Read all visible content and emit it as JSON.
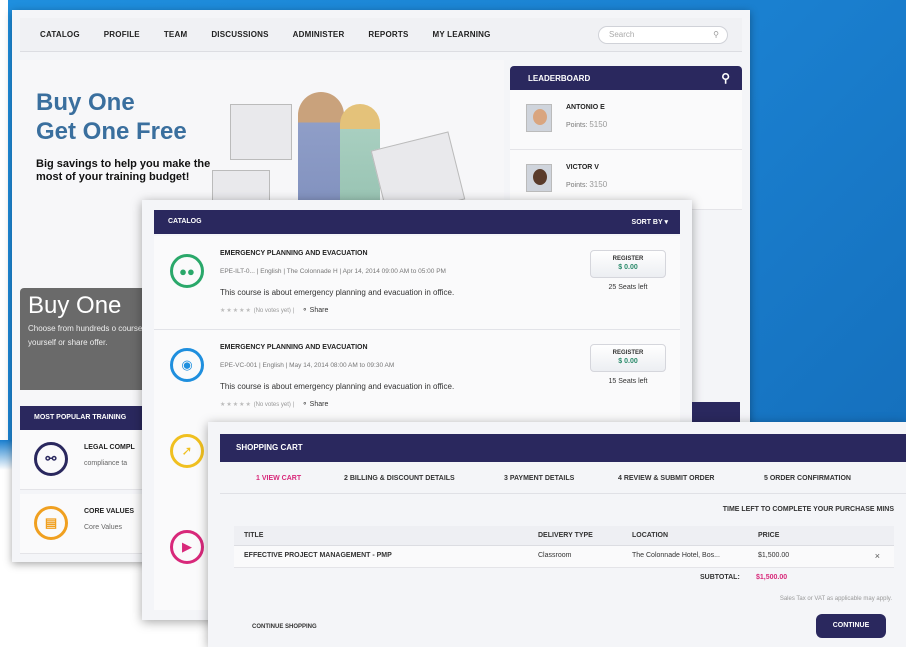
{
  "colors": {
    "navy": "#2a285e",
    "accent_pink": "#d8287a",
    "background_blue": "#1f8fde"
  },
  "nav": {
    "items": [
      "CATALOG",
      "PROFILE",
      "TEAM",
      "DISCUSSIONS",
      "ADMINISTER",
      "REPORTS",
      "MY LEARNING"
    ],
    "search_placeholder": "Search"
  },
  "banner": {
    "line1": "Buy One",
    "line2": "Get One Free",
    "sub": "Big savings to help you make the most of your training budget!"
  },
  "promo": {
    "title": "Buy One",
    "text": "Choose from hundreds o courses yourself or share offer."
  },
  "popular": {
    "title": "MOST POPULAR TRAINING",
    "items": [
      {
        "name": "LEGAL COMPL",
        "sub": "compliance ta",
        "icon": "network-icon"
      },
      {
        "name": "CORE VALUES",
        "sub": "Core Values",
        "icon": "books-icon"
      }
    ]
  },
  "leaderboard": {
    "title": "LEADERBOARD",
    "items": [
      {
        "name": "ANTONIO E",
        "points_label": "Points:",
        "points": "5150"
      },
      {
        "name": "VICTOR V",
        "points_label": "Points:",
        "points": "3150"
      }
    ]
  },
  "catalog": {
    "title": "CATALOG",
    "sort": "SORT BY",
    "courses": [
      {
        "title": "EMERGENCY PLANNING AND EVACUATION",
        "meta": "EPE-ILT-0...  |  English  |  The Colonnade H  |  Apr 14, 2014 09:00 AM to 05:00 PM",
        "desc": "This course is about emergency planning and evacuation in office.",
        "votes": "(No votes yet)",
        "share": "Share",
        "register": "REGISTER",
        "price": "$ 0.00",
        "seats": "25 Seats left"
      },
      {
        "title": "EMERGENCY PLANNING AND EVACUATION",
        "meta": "EPE-VC-001  |  English  |  May 14, 2014 08:00 AM to 09:30 AM",
        "desc": "This course is about emergency planning and evacuation in office.",
        "votes": "(No votes yet)",
        "share": "Share",
        "register": "REGISTER",
        "price": "$ 0.00",
        "seats": "15 Seats left"
      }
    ]
  },
  "cart": {
    "title": "SHOPPING CART",
    "steps": [
      "1 VIEW CART",
      "2 BILLING & DISCOUNT DETAILS",
      "3 PAYMENT DETAILS",
      "4 REVIEW & SUBMIT ORDER",
      "5 ORDER CONFIRMATION"
    ],
    "time_left": "TIME LEFT TO COMPLETE YOUR PURCHASE  MINS",
    "columns": [
      "TITLE",
      "DELIVERY TYPE",
      "LOCATION",
      "PRICE"
    ],
    "row": [
      "EFFECTIVE PROJECT MANAGEMENT - PMP",
      "Classroom",
      "The Colonnade Hotel, Bos...",
      "$1,500.00"
    ],
    "remove": "×",
    "subtotal_label": "SUBTOTAL:",
    "subtotal_value": "$1,500.00",
    "tax_note": "Sales Tax or VAT as applicable may apply.",
    "continue_shopping": "CONTINUE SHOPPING",
    "continue": "CONTINUE"
  }
}
